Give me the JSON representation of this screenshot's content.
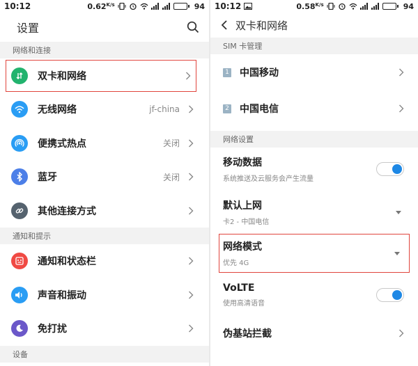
{
  "left": {
    "status": {
      "time": "10:12",
      "speed": "0.62",
      "speed_unit": "K/s",
      "battery": "94",
      "battery_level": 0.94
    },
    "title": "设置",
    "sections": {
      "network": "网络和连接",
      "notify": "通知和提示",
      "device": "设备"
    },
    "items": [
      {
        "label": "双卡和网络",
        "value": "",
        "icon": "dual-sim-icon",
        "color": "#22b36e"
      },
      {
        "label": "无线网络",
        "value": "jf-china",
        "icon": "wifi-icon",
        "color": "#2a9df4"
      },
      {
        "label": "便携式热点",
        "value": "关闭",
        "icon": "hotspot-icon",
        "color": "#2a9df4"
      },
      {
        "label": "蓝牙",
        "value": "关闭",
        "icon": "bluetooth-icon",
        "color": "#4c7fe8"
      },
      {
        "label": "其他连接方式",
        "value": "",
        "icon": "link-icon",
        "color": "#55626e"
      },
      {
        "label": "通知和状态栏",
        "value": "",
        "icon": "notification-icon",
        "color": "#f04a44"
      },
      {
        "label": "声音和振动",
        "value": "",
        "icon": "sound-icon",
        "color": "#2a9df4"
      },
      {
        "label": "免打扰",
        "value": "",
        "icon": "moon-icon",
        "color": "#6b58c9"
      }
    ]
  },
  "right": {
    "status": {
      "time": "10:12",
      "speed": "0.58",
      "speed_unit": "K/s",
      "battery": "94",
      "battery_level": 0.94
    },
    "title": "双卡和网络",
    "sections": {
      "sim": "SIM 卡管理",
      "network": "网络设置"
    },
    "sims": [
      {
        "num": "1",
        "label": "中国移动"
      },
      {
        "num": "2",
        "label": "中国电信"
      }
    ],
    "settings": {
      "mobile_data": {
        "label": "移动数据",
        "sub": "系统推送及云服务会产生流量"
      },
      "default_net": {
        "label": "默认上网",
        "sub": "卡2 - 中国电信"
      },
      "net_mode": {
        "label": "网络模式",
        "sub": "优先 4G"
      },
      "volte": {
        "label": "VoLTE",
        "sub": "使用高清语音"
      },
      "pseudo": {
        "label": "伪基站拦截"
      }
    }
  },
  "colors": {
    "accent": "#1e88e5",
    "highlight": "#e0443c"
  }
}
